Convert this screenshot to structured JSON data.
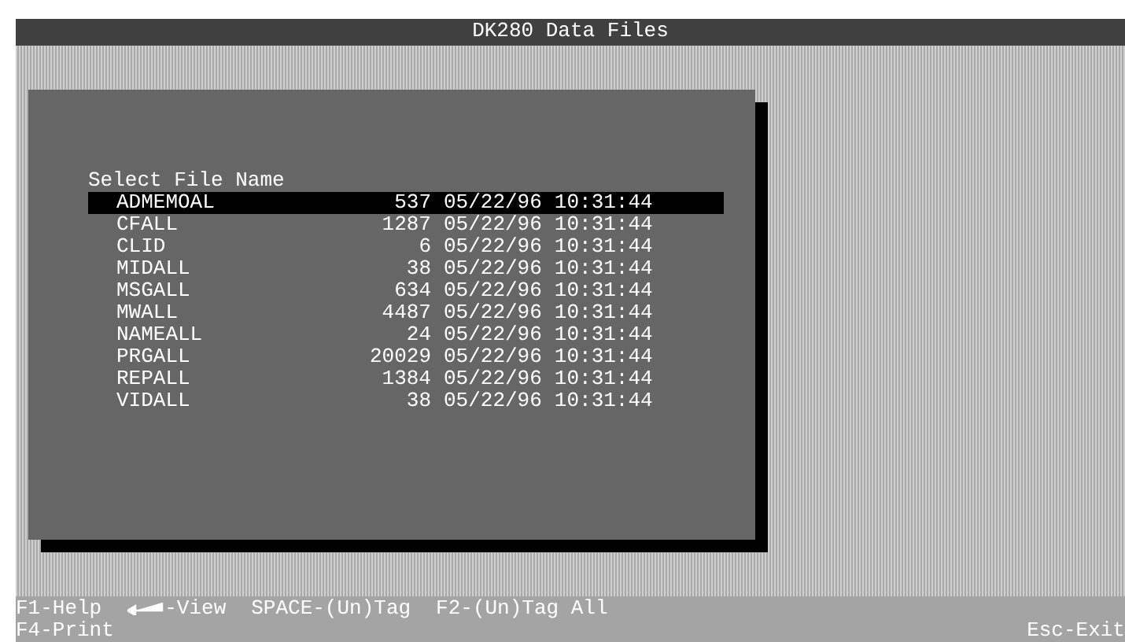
{
  "window": {
    "title": "DK280 Data Files"
  },
  "dialog": {
    "heading": "Select File Name",
    "files": [
      {
        "name": "ADMEMOAL",
        "size": "537",
        "date": "05/22/96",
        "time": "10:31:44",
        "selected": true
      },
      {
        "name": "CFALL",
        "size": "1287",
        "date": "05/22/96",
        "time": "10:31:44",
        "selected": false
      },
      {
        "name": "CLID",
        "size": "6",
        "date": "05/22/96",
        "time": "10:31:44",
        "selected": false
      },
      {
        "name": "MIDALL",
        "size": "38",
        "date": "05/22/96",
        "time": "10:31:44",
        "selected": false
      },
      {
        "name": "MSGALL",
        "size": "634",
        "date": "05/22/96",
        "time": "10:31:44",
        "selected": false
      },
      {
        "name": "MWALL",
        "size": "4487",
        "date": "05/22/96",
        "time": "10:31:44",
        "selected": false
      },
      {
        "name": "NAMEALL",
        "size": "24",
        "date": "05/22/96",
        "time": "10:31:44",
        "selected": false
      },
      {
        "name": "PRGALL",
        "size": "20029",
        "date": "05/22/96",
        "time": "10:31:44",
        "selected": false
      },
      {
        "name": "REPALL",
        "size": "1384",
        "date": "05/22/96",
        "time": "10:31:44",
        "selected": false
      },
      {
        "name": "VIDALL",
        "size": "38",
        "date": "05/22/96",
        "time": "10:31:44",
        "selected": false
      }
    ]
  },
  "help_bar": {
    "line_1": [
      {
        "kind": "text",
        "text": "F1-Help"
      },
      {
        "kind": "enter",
        "text": "-View"
      },
      {
        "kind": "text",
        "text": "SPACE-(Un)Tag"
      },
      {
        "kind": "text",
        "text": "F2-(Un)Tag All"
      }
    ],
    "line_2_left": "F4-Print",
    "line_2_right": "Esc-Exit"
  }
}
